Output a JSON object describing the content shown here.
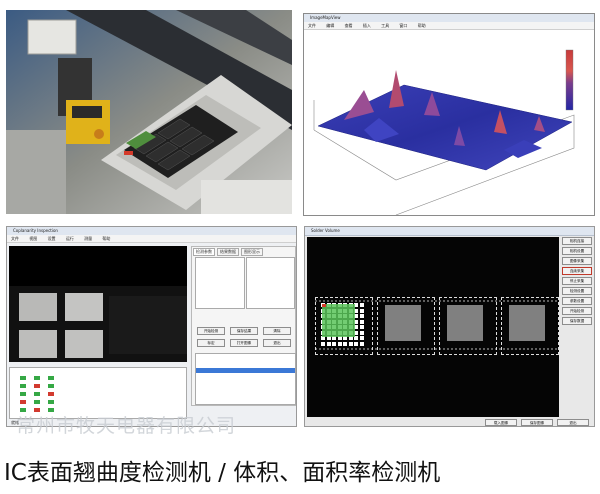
{
  "caption": "IC表面翘曲度检测机 / 体积、面积率检测机",
  "watermark": "常州市牧天电器有限公司",
  "panel3d": {
    "window_title": "ImageMapView",
    "menu": [
      "文件",
      "编辑",
      "查看",
      "插入",
      "工具",
      "窗口",
      "帮助"
    ]
  },
  "panel_inspect": {
    "window_title": "Coplanarity Inspection",
    "menu": [
      "文件",
      "视图",
      "设置",
      "运行",
      "测量",
      "帮助"
    ],
    "tabs": [
      "检测参数",
      "结果数据",
      "图形显示"
    ],
    "buttons": [
      "开始检测",
      "保存结果",
      "清除",
      "标定",
      "打开图像",
      "退出"
    ],
    "status": "就绪"
  },
  "panel_volume": {
    "window_title": "Solder Volume",
    "side_buttons": [
      "相机连接",
      "相机设置",
      "图像采集",
      "连续采集",
      "停止采集",
      "检测设置",
      "参数设置",
      "开始检测",
      "保存数据"
    ],
    "bottom_buttons": [
      "载入图像",
      "保存图像",
      "退出"
    ]
  },
  "colors": {
    "surface_low": "#2a2fa0",
    "surface_high": "#d33b3b",
    "grid_green": "#5bc45a",
    "screen_bg": "#050505"
  }
}
